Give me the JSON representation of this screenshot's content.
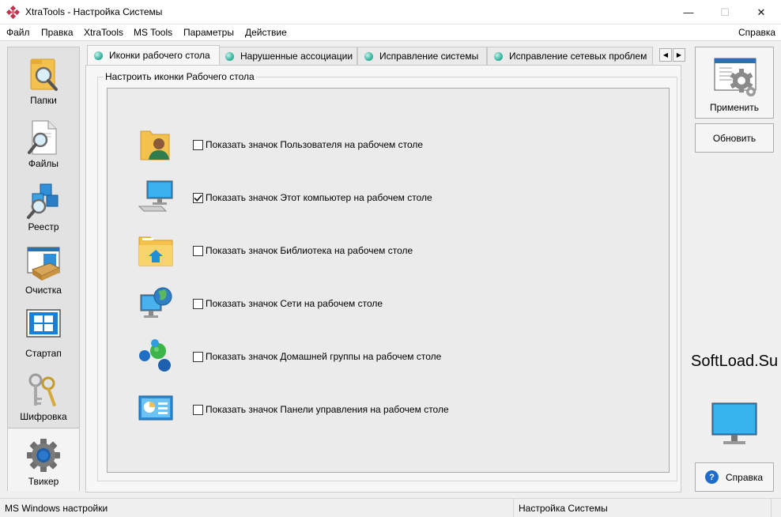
{
  "window": {
    "title": "XtraTools - Настройка Системы",
    "minimize_glyph": "—",
    "maximize_glyph": "☐",
    "close_glyph": "✕"
  },
  "menu": {
    "items": [
      "Файл",
      "Правка",
      "XtraTools",
      "MS Tools",
      "Параметры",
      "Действие"
    ],
    "help": "Справка"
  },
  "sidebar": {
    "items": [
      {
        "label": "Папки",
        "icon": "folder-search-icon"
      },
      {
        "label": "Файлы",
        "icon": "file-search-icon"
      },
      {
        "label": "Реестр",
        "icon": "registry-cubes-icon"
      },
      {
        "label": "Очистка",
        "icon": "cleanup-box-icon"
      },
      {
        "label": "Стартап",
        "icon": "windows-startup-icon"
      },
      {
        "label": "Шифровка",
        "icon": "keys-icon"
      },
      {
        "label": "Твикер",
        "icon": "gear-icon",
        "active": true
      }
    ]
  },
  "tabs": [
    {
      "label": "Иконки рабочего стола",
      "active": true
    },
    {
      "label": "Нарушенные ассоциации"
    },
    {
      "label": "Исправление системы"
    },
    {
      "label": "Исправление сетевых проблем"
    }
  ],
  "tab_scroll": {
    "left": "◀",
    "right": "▶"
  },
  "group": {
    "title": "Настроить иконки Рабочего стола",
    "options": [
      {
        "label": "Показать значок Пользователя на рабочем столе",
        "checked": false,
        "icon": "user-folder-icon"
      },
      {
        "label": "Показать значок Этот компьютер на рабочем столе",
        "checked": true,
        "icon": "computer-icon"
      },
      {
        "label": "Показать значок Библиотека на рабочем столе",
        "checked": false,
        "icon": "library-folder-icon"
      },
      {
        "label": "Показать значок Сети на рабочем столе",
        "checked": false,
        "icon": "network-globe-icon"
      },
      {
        "label": "Показать значок Домашней группы на рабочем столе",
        "checked": false,
        "icon": "homegroup-icon"
      },
      {
        "label": "Показать значок Панели управления на рабочем столе",
        "checked": false,
        "icon": "control-panel-icon"
      }
    ]
  },
  "buttons": {
    "apply": "Применить",
    "refresh": "Обновить",
    "help": "Справка",
    "help_glyph": "?"
  },
  "watermark": "SoftLoad.Su",
  "status": {
    "left": "MS Windows настройки",
    "right": "Настройка Системы"
  },
  "colors": {
    "accent_blue": "#1e6ec9",
    "tab_dot": "#3fbaa6",
    "folder_yellow": "#f2c14e"
  }
}
